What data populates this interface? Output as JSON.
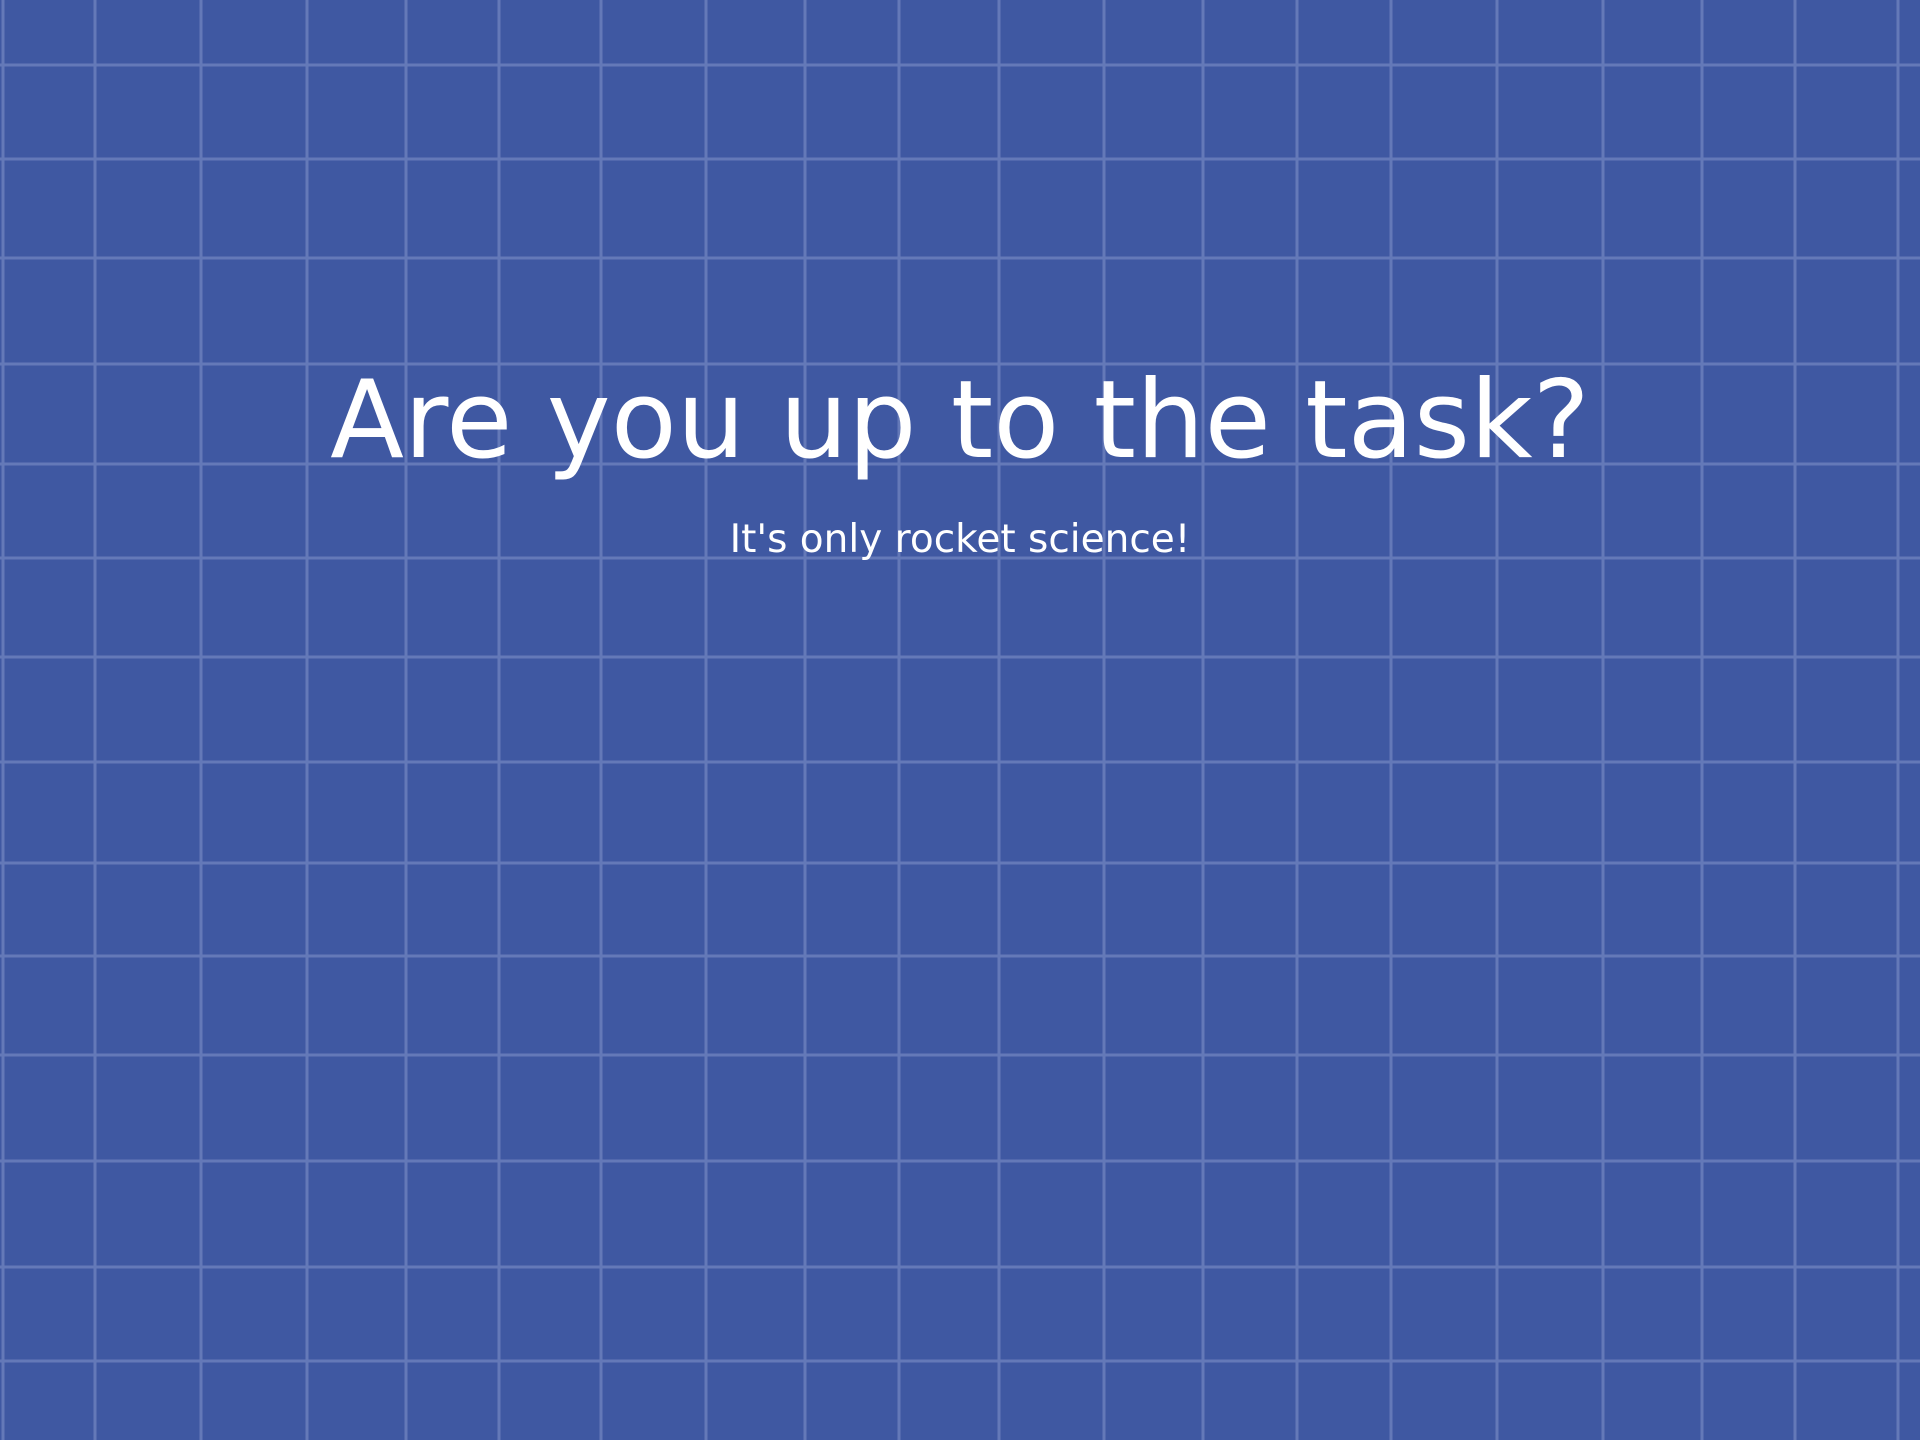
{
  "page": {
    "background_color": "#3f58a2",
    "grid_line_color": "#6479b8",
    "text_color": "#ffffff"
  },
  "hero": {
    "title": "Are you up to the task?",
    "subtitle": "It's only rocket science!"
  }
}
